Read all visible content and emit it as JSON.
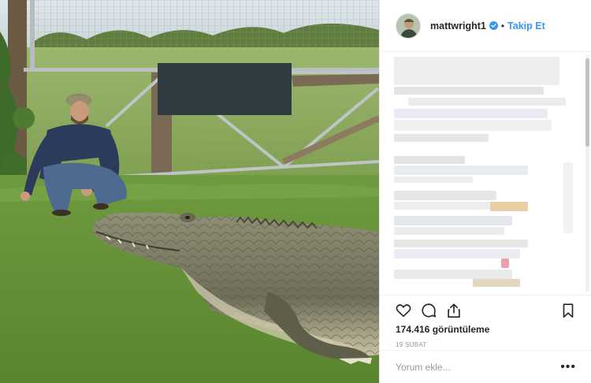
{
  "header": {
    "username": "mattwright1",
    "separator": "•",
    "follow_label": "Takip Et",
    "verified_icon": "verified-badge-icon"
  },
  "actions": {
    "icons": [
      "heart-icon",
      "comment-icon",
      "share-icon",
      "bookmark-icon"
    ]
  },
  "stats": {
    "views": "174.416 görüntüleme",
    "date": "19 ŞUBAT"
  },
  "comment_box": {
    "placeholder": "Yorum ekle...",
    "more_label": "•••"
  },
  "colors": {
    "accent": "#3897f0",
    "text": "#262626",
    "muted": "#999999",
    "border": "#efefef"
  }
}
